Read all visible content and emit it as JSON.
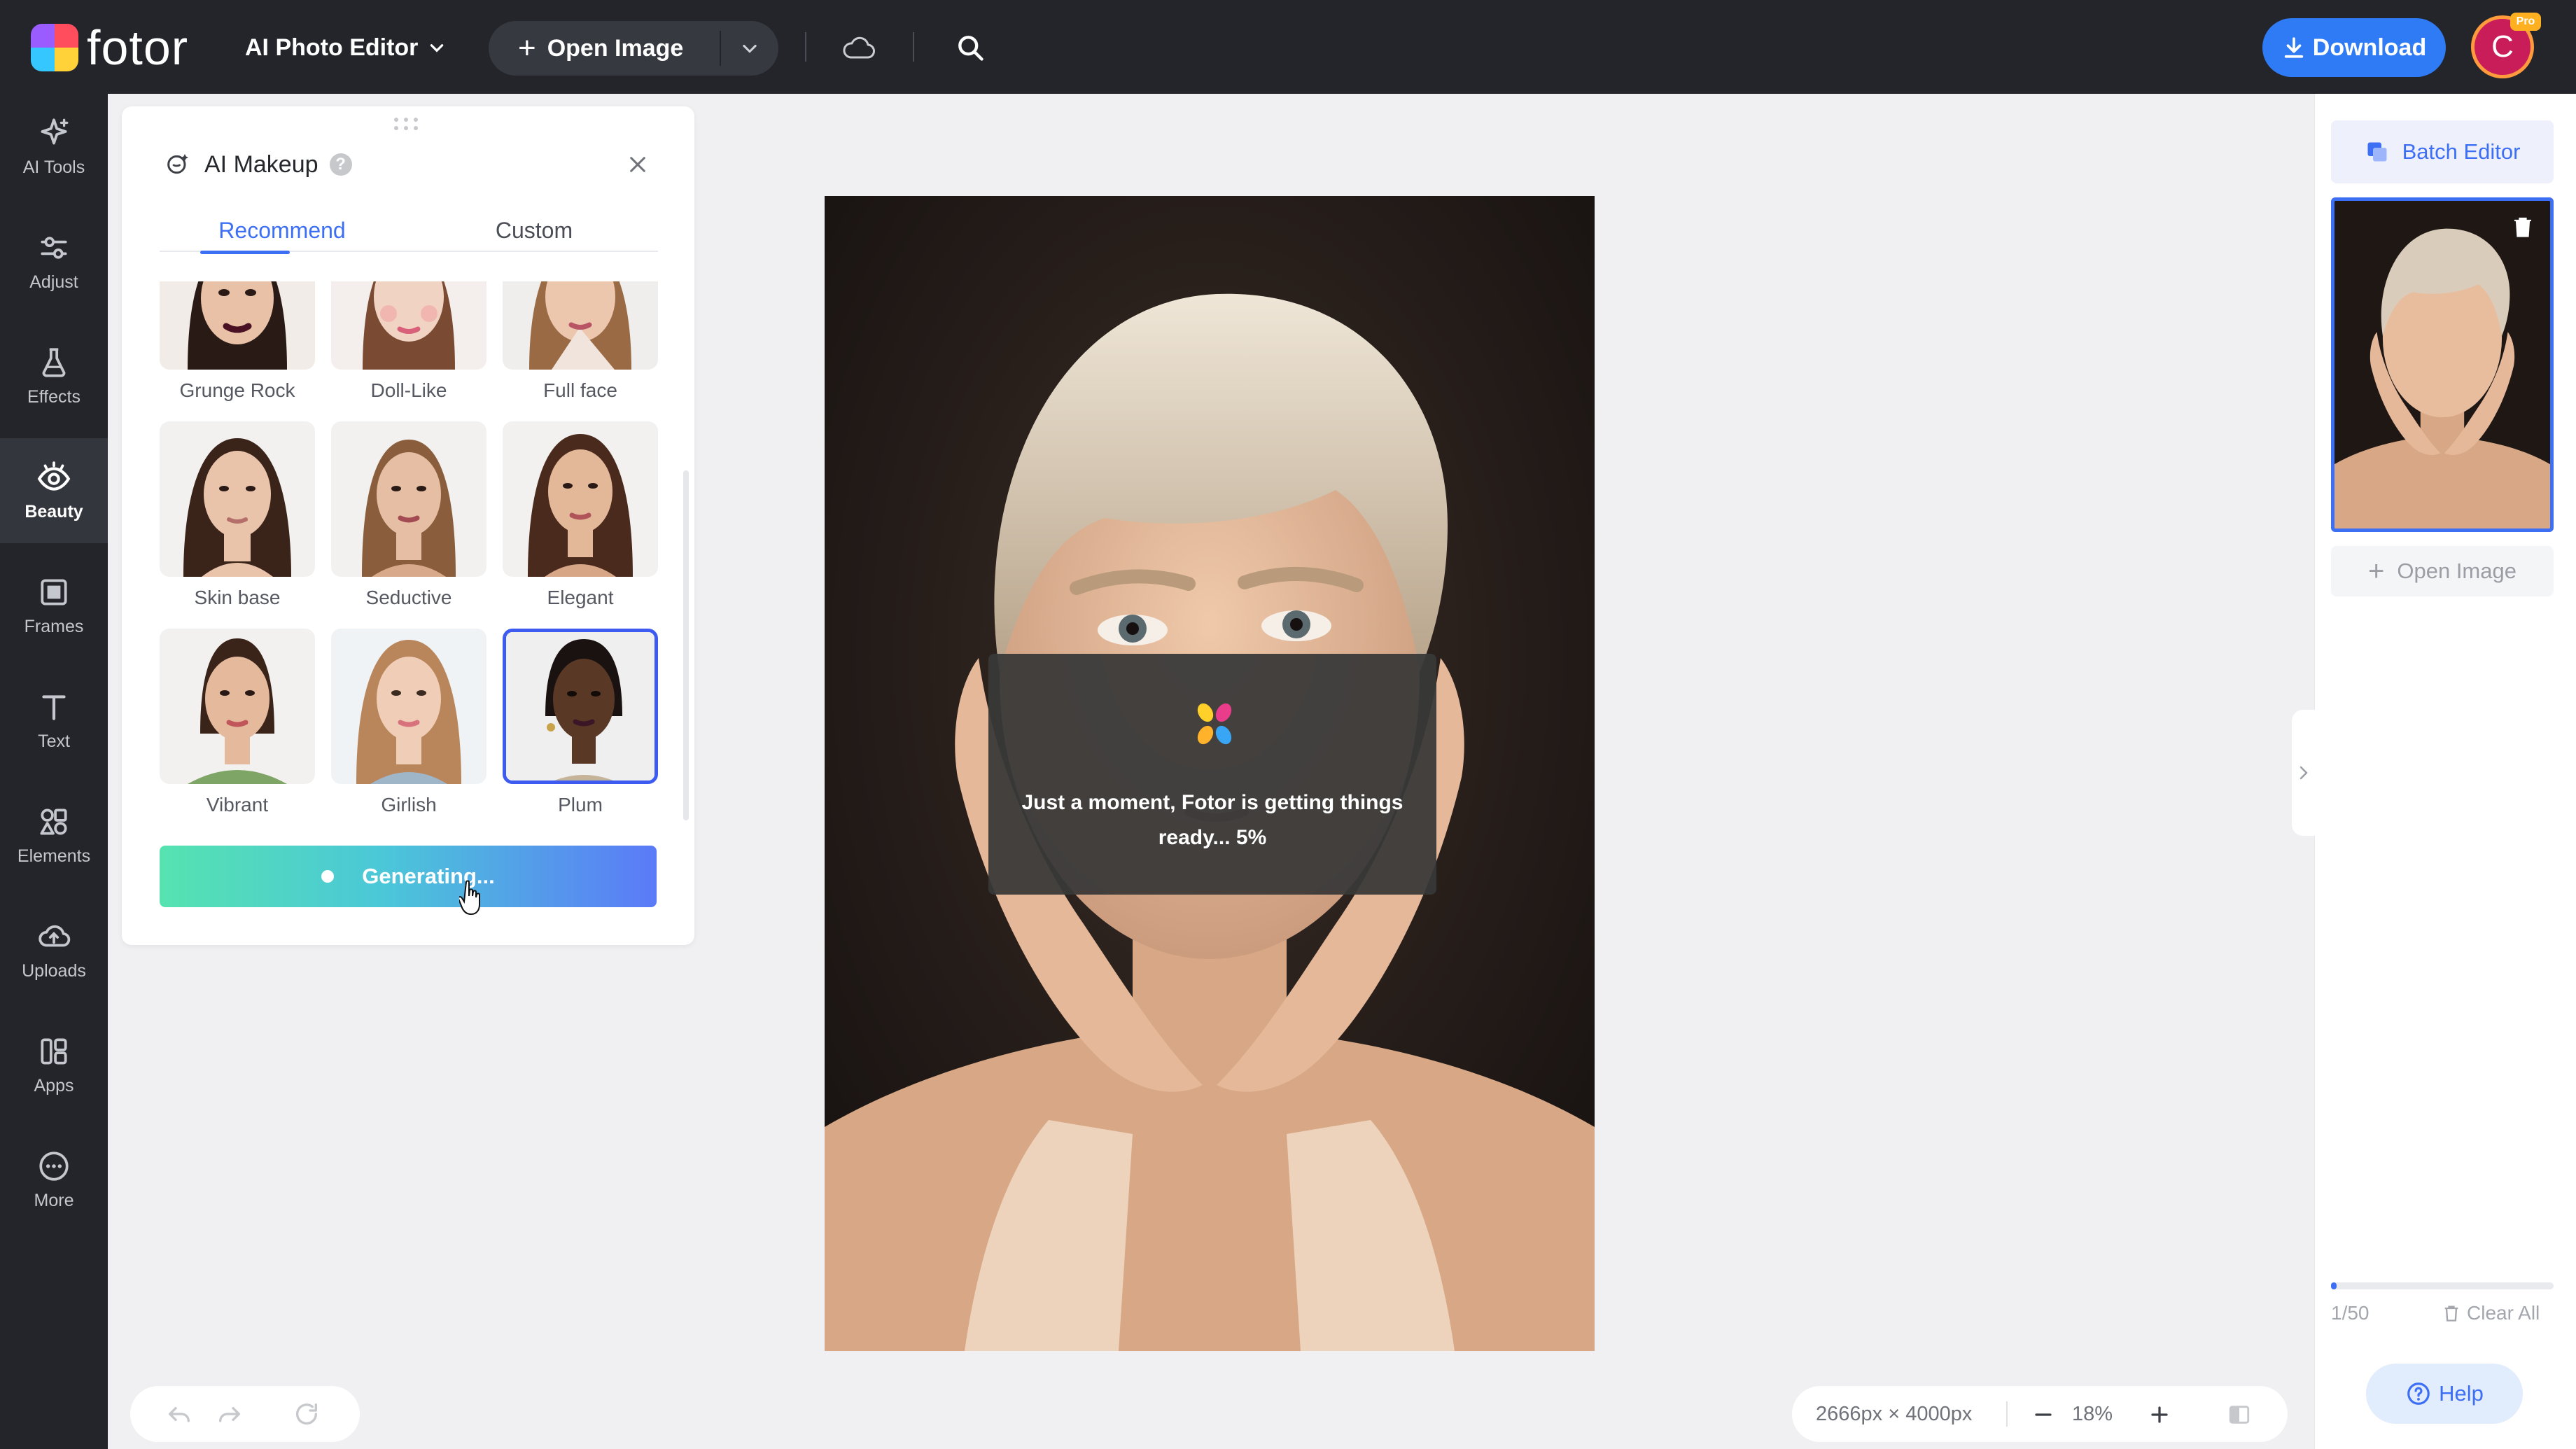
{
  "app": {
    "logo_text": "fotor",
    "product": "AI Photo Editor"
  },
  "toolbar": {
    "open_image": "Open Image",
    "download": "Download",
    "avatar_initial": "C",
    "pro_badge": "Pro"
  },
  "sidebar": {
    "items": [
      {
        "label": "AI Tools",
        "icon": "sparkle-icon",
        "active": false
      },
      {
        "label": "Adjust",
        "icon": "sliders-icon",
        "active": false
      },
      {
        "label": "Effects",
        "icon": "flask-icon",
        "active": false
      },
      {
        "label": "Beauty",
        "icon": "eye-icon",
        "active": true
      },
      {
        "label": "Frames",
        "icon": "frame-icon",
        "active": false
      },
      {
        "label": "Text",
        "icon": "text-icon",
        "active": false
      },
      {
        "label": "Elements",
        "icon": "shapes-icon",
        "active": false
      },
      {
        "label": "Uploads",
        "icon": "cloud-upload-icon",
        "active": false
      },
      {
        "label": "Apps",
        "icon": "apps-icon",
        "active": false
      },
      {
        "label": "More",
        "icon": "more-icon",
        "active": false
      }
    ]
  },
  "panel": {
    "title": "AI Makeup",
    "tabs": [
      {
        "label": "Recommend",
        "active": true
      },
      {
        "label": "Custom",
        "active": false
      }
    ],
    "presets": [
      {
        "label": "Grunge Rock",
        "selected": false
      },
      {
        "label": "Doll-Like",
        "selected": false
      },
      {
        "label": "Full face",
        "selected": false
      },
      {
        "label": "Skin base",
        "selected": false
      },
      {
        "label": "Seductive",
        "selected": false
      },
      {
        "label": "Elegant",
        "selected": false
      },
      {
        "label": "Vibrant",
        "selected": false
      },
      {
        "label": "Girlish",
        "selected": false
      },
      {
        "label": "Plum",
        "selected": true
      }
    ],
    "generate_label": "Generating..."
  },
  "canvas": {
    "loading_text": "Just a moment, Fotor is getting things ready... 5%",
    "dimensions": "2666px × 4000px",
    "zoom": "18%"
  },
  "right_panel": {
    "batch_editor": "Batch Editor",
    "open_image": "Open Image",
    "page_count": "1/50",
    "progress_fraction": 0.02,
    "clear_all": "Clear All",
    "help": "Help"
  },
  "colors": {
    "accent": "#3d6ff5",
    "download": "#2f7bf5",
    "topbar": "#23252a",
    "generate_gradient_start": "#56e3b0",
    "generate_gradient_end": "#5b7af8"
  }
}
